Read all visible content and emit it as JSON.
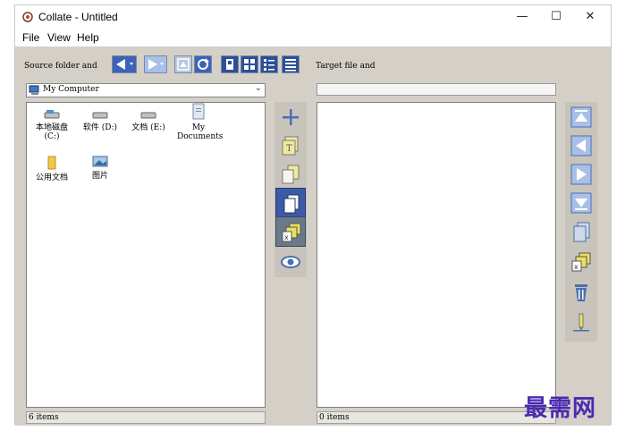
{
  "window": {
    "title": "Collate - Untitled",
    "controls": {
      "minimize": "—",
      "maximize": "☐",
      "close": "✕"
    }
  },
  "menu": {
    "items": [
      "File",
      "View",
      "Help"
    ]
  },
  "toolbar": {
    "source_label": "Source folder and",
    "target_label": "Target file and"
  },
  "source": {
    "location": "My Computer",
    "items": [
      {
        "label": "本地磁盘\n(C:)",
        "icon": "drive-icon"
      },
      {
        "label": "软件 (D:)",
        "icon": "drive-icon"
      },
      {
        "label": "文档 (E:)",
        "icon": "drive-icon"
      },
      {
        "label": "My\nDocuments",
        "icon": "documents-icon"
      },
      {
        "label": "公用文档",
        "icon": "folder-icon"
      },
      {
        "label": "图片",
        "icon": "pictures-icon"
      }
    ],
    "status": "6 items"
  },
  "target": {
    "path": "",
    "status": "0 items"
  },
  "watermark": "最需网",
  "colors": {
    "panel": "#d4d0c8",
    "button_blue": "#4a6fb0",
    "accent_yellow": "#e8e060",
    "watermark": "#4a2bb0"
  }
}
